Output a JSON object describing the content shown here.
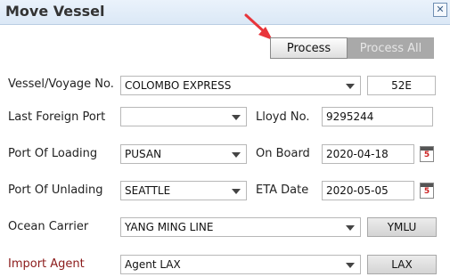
{
  "window": {
    "title": "Move Vessel",
    "close_glyph": "✕"
  },
  "toolbar": {
    "process_label": "Process",
    "process_all_label": "Process All"
  },
  "fields": {
    "vessel_voyage": {
      "label": "Vessel/Voyage No.",
      "value": "COLOMBO EXPRESS",
      "voyage": "52E"
    },
    "last_foreign_port": {
      "label": "Last Foreign Port",
      "value": ""
    },
    "lloyd_no": {
      "label": "Lloyd No.",
      "value": "9295244"
    },
    "port_of_loading": {
      "label": "Port Of Loading",
      "value": "PUSAN"
    },
    "on_board": {
      "label": "On Board",
      "value": "2020-04-18"
    },
    "port_of_unlading": {
      "label": "Port Of Unlading",
      "value": "SEATTLE"
    },
    "eta_date": {
      "label": "ETA Date",
      "value": "2020-05-05"
    },
    "ocean_carrier": {
      "label": "Ocean Carrier",
      "value": "YANG MING LINE",
      "code": "YMLU"
    },
    "import_agent": {
      "label": "Import Agent",
      "value": "Agent LAX",
      "code": "LAX"
    }
  },
  "calendar_day": "5",
  "colors": {
    "accent_red": "#8b1a1a",
    "annotation_arrow": "#e8353b",
    "title_bar": "#dbe8f6"
  }
}
